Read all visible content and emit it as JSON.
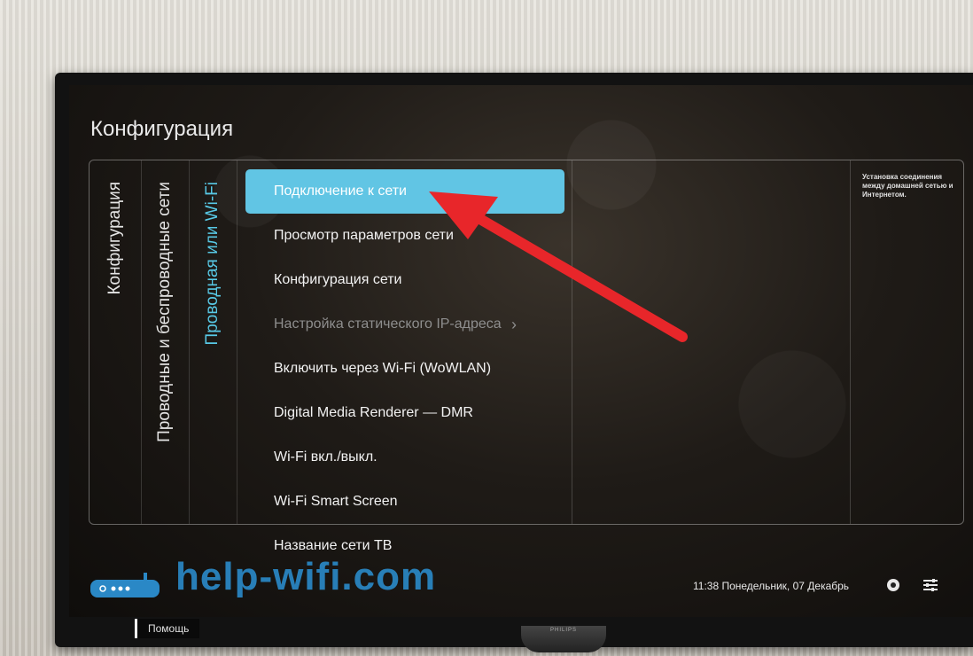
{
  "screen": {
    "title": "Конфигурация",
    "breadcrumbs": [
      "Конфигурация",
      "Проводные и беспроводные сети",
      "Проводная или Wi-Fi"
    ],
    "menu": [
      {
        "label": "Подключение к сети",
        "state": "selected"
      },
      {
        "label": "Просмотр параметров сети",
        "state": "normal"
      },
      {
        "label": "Конфигурация сети",
        "state": "normal"
      },
      {
        "label": "Настройка статического IP-адреса",
        "state": "disabled"
      },
      {
        "label": "Включить через Wi-Fi (WoWLAN)",
        "state": "normal"
      },
      {
        "label": "Digital Media Renderer — DMR",
        "state": "normal"
      },
      {
        "label": "Wi-Fi вкл./выкл.",
        "state": "normal"
      },
      {
        "label": "Wi-Fi Smart Screen",
        "state": "normal"
      },
      {
        "label": "Название сети ТВ",
        "state": "normal"
      }
    ],
    "chevron": "›",
    "help_description": "Установка соединения между домашней сетью и Интернетом.",
    "status": {
      "datetime": "11:38 Понедельник, 07 Декабрь"
    },
    "help_button": "Помощь"
  },
  "watermark": "help-wifi.com",
  "brand": "PHILIPS",
  "colors": {
    "accent": "#61c5e4",
    "active_breadcrumb": "#58c9e6",
    "annotation_arrow": "#e8262a",
    "watermark": "#2a88c6"
  }
}
